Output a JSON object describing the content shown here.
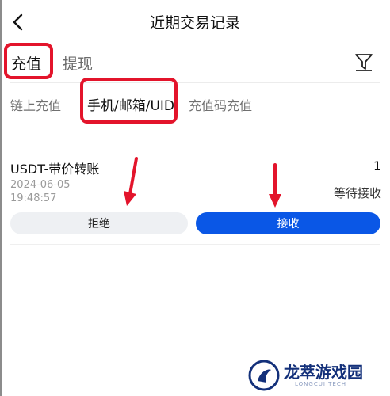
{
  "header": {
    "title": "近期交易记录",
    "back_icon": "back-arrow-icon"
  },
  "tabs": [
    {
      "label": "充值",
      "active": true
    },
    {
      "label": "提现",
      "active": false
    }
  ],
  "filter_icon": "filter-icon",
  "subtabs": [
    {
      "label": "链上充值",
      "active": false
    },
    {
      "label": "手机/邮箱/UID",
      "active": true
    },
    {
      "label": "充值码充值",
      "active": false
    }
  ],
  "record": {
    "name": "USDT-带价转账",
    "count": "1",
    "date": "2024-06-05",
    "time": "19:48:57",
    "status": "等待接收",
    "reject_label": "拒绝",
    "accept_label": "接收"
  },
  "watermark": {
    "brand": "龙萃游戏园",
    "sub": "LONGCUI TECH"
  },
  "colors": {
    "accent_blue": "#0a57e6",
    "highlight_red": "#e3142b",
    "reject_bg": "#eef0f3",
    "watermark_navy": "#13307a"
  }
}
